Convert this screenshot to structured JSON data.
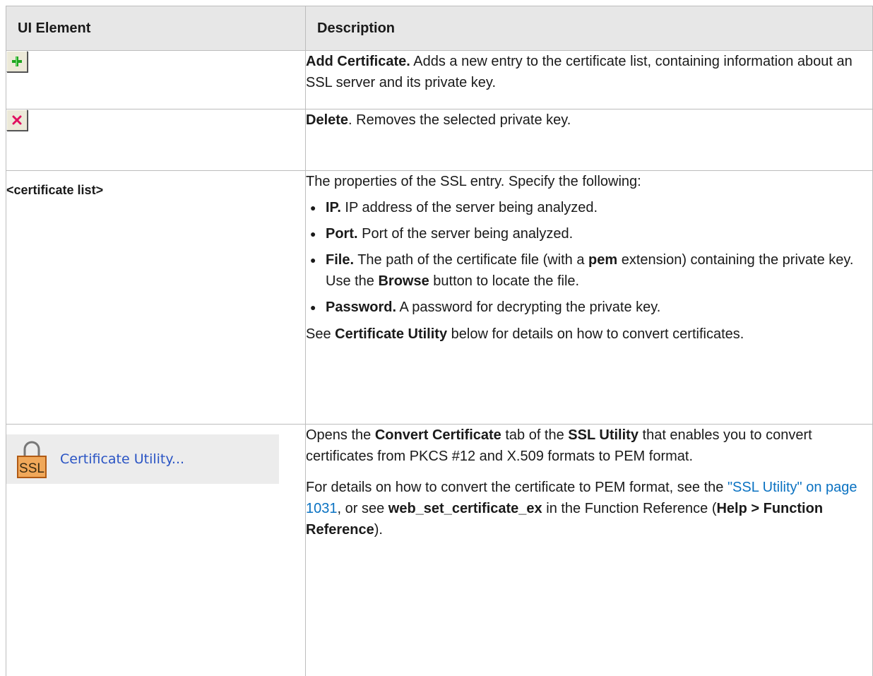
{
  "header": {
    "col_ui_element": "UI Element",
    "col_description": "Description"
  },
  "rows": {
    "add": {
      "icon": "add-plus-icon",
      "title": "Add Certificate.",
      "text": " Adds a new entry to the certificate list, containing information about an SSL server and its private key."
    },
    "delete": {
      "icon": "delete-x-icon",
      "title": "Delete",
      "text": ". Removes the selected private key."
    },
    "list": {
      "label": "<certificate list>",
      "intro": "The properties of the SSL entry. Specify the following:",
      "items": [
        {
          "title": "IP.",
          "text": " IP address of the server being analyzed."
        },
        {
          "title": "Port.",
          "text": " Port of the server being analyzed."
        },
        {
          "title": "File.",
          "text_a": " The path of the certificate file (with a ",
          "bold_a": "pem",
          "text_b": " extension) containing the private key. Use the ",
          "bold_b": "Browse",
          "text_c": " button to locate the file."
        },
        {
          "title": "Password.",
          "text": " A password for decrypting the private key."
        }
      ],
      "see_a": "See ",
      "see_bold": "Certificate Utility",
      "see_b": " below for details on how to convert certificates."
    },
    "utility": {
      "icon": "ssl-lock-icon",
      "icon_text": "SSL",
      "button_label": "Certificate Utility...",
      "p1_a": "Opens the ",
      "p1_bold_a": "Convert Certificate",
      "p1_b": " tab of the ",
      "p1_bold_b": "SSL Utility",
      "p1_c": " that enables you to convert certificates from PKCS #12 and X.509 formats to PEM format.",
      "p2_a": "For details on how to convert the certificate to PEM format, see the ",
      "p2_link": "\"SSL Utility\" on page 1031",
      "p2_b": ", or see ",
      "p2_bold_a": "web_set_certificate_ex",
      "p2_c": " in the  Function Reference (",
      "p2_bold_b": "Help > Function Reference",
      "p2_d": ")."
    }
  },
  "colors": {
    "header_bg": "#e7e7e7",
    "border": "#bdbdbd",
    "link": "#0a72c2",
    "plus_green": "#1fa51f",
    "x_magenta": "#e0115f",
    "ssl_orange": "#f0a85a"
  }
}
